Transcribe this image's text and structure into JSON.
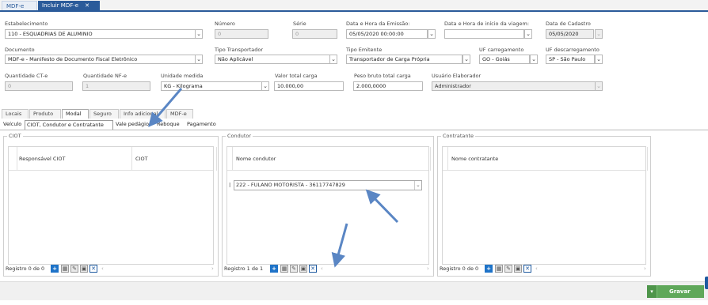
{
  "tabs": {
    "items": [
      {
        "label": "MDF-e",
        "closable": false
      },
      {
        "label": "Incluir MDF-e",
        "closable": true,
        "close_glyph": "✕"
      }
    ]
  },
  "form": {
    "estabelecimento": {
      "label": "Estabelecimento",
      "value": "110 - ESQUADRIAS DE ALUMINIO"
    },
    "numero": {
      "label": "Número",
      "value": "0"
    },
    "serie": {
      "label": "Série",
      "value": "0"
    },
    "data_emissao": {
      "label": "Data e Hora da Emissão:",
      "value": "05/05/2020 00:00:00"
    },
    "data_inicio_viagem": {
      "label": "Data e Hora de início da viagem:",
      "value": ""
    },
    "data_cadastro": {
      "label": "Data de Cadastro",
      "value": "05/05/2020"
    },
    "documento": {
      "label": "Documento",
      "value": "MDF-e - Manifesto de Documento Fiscal Eletrônico"
    },
    "tipo_transportador": {
      "label": "Tipo Transportador",
      "value": "Não Aplicável"
    },
    "tipo_emitente": {
      "label": "Tipo Emitente",
      "value": "Transportador de Carga Própria"
    },
    "uf_carregamento": {
      "label": "UF carregamento",
      "value": "GO - Goiás"
    },
    "uf_descarregamento": {
      "label": "UF descarregamento",
      "value": "SP - São Paulo"
    },
    "quantidade_cte": {
      "label": "Quantidade CT-e",
      "value": "0"
    },
    "quantidade_nfe": {
      "label": "Quantidade NF-e",
      "value": "1"
    },
    "unidade_medida": {
      "label": "Unidade medida",
      "value": "KG - Kilograma"
    },
    "valor_total_carga": {
      "label": "Valor total carga",
      "value": "10.000,00"
    },
    "peso_bruto": {
      "label": "Peso bruto total carga",
      "value": "2.000,0000"
    },
    "usuario_elaborador": {
      "label": "Usuário Elaborador",
      "value": "Administrador"
    }
  },
  "main_tabs": [
    "Locais",
    "Produto",
    "Modal",
    "Seguro",
    "Info adicional",
    "MDF-e"
  ],
  "main_tabs_active": "Modal",
  "sub_tabs": [
    "Veículo",
    "CIOT, Condutor e Contratante",
    "Vale pedágio",
    "Reboque",
    "Pagamento"
  ],
  "sub_tabs_active": "CIOT, Condutor e Contratante",
  "panels": {
    "ciot": {
      "title": "CIOT",
      "columns": [
        "Responsável CIOT",
        "CIOT"
      ],
      "pager": "Registro 0 de 0"
    },
    "condutor": {
      "title": "Condutor",
      "columns": [
        "Nome condutor"
      ],
      "selected_row": "222 - FULANO MOTORISTA - 36117747829",
      "pager": "Registro 1 de 1"
    },
    "contratante": {
      "title": "Contratante",
      "columns": [
        "Nome contratante"
      ],
      "pager": "Registro 0 de 0"
    }
  },
  "save_button": {
    "label": "Gravar"
  },
  "colors": {
    "primary": "#2b5b9a",
    "annotation_arrow": "#5a86c4",
    "save": "#5fa85a"
  },
  "icons": [
    "add-icon",
    "table-icon",
    "edit-icon",
    "save-icon",
    "delete-icon",
    "dropdown-caret-icon"
  ]
}
